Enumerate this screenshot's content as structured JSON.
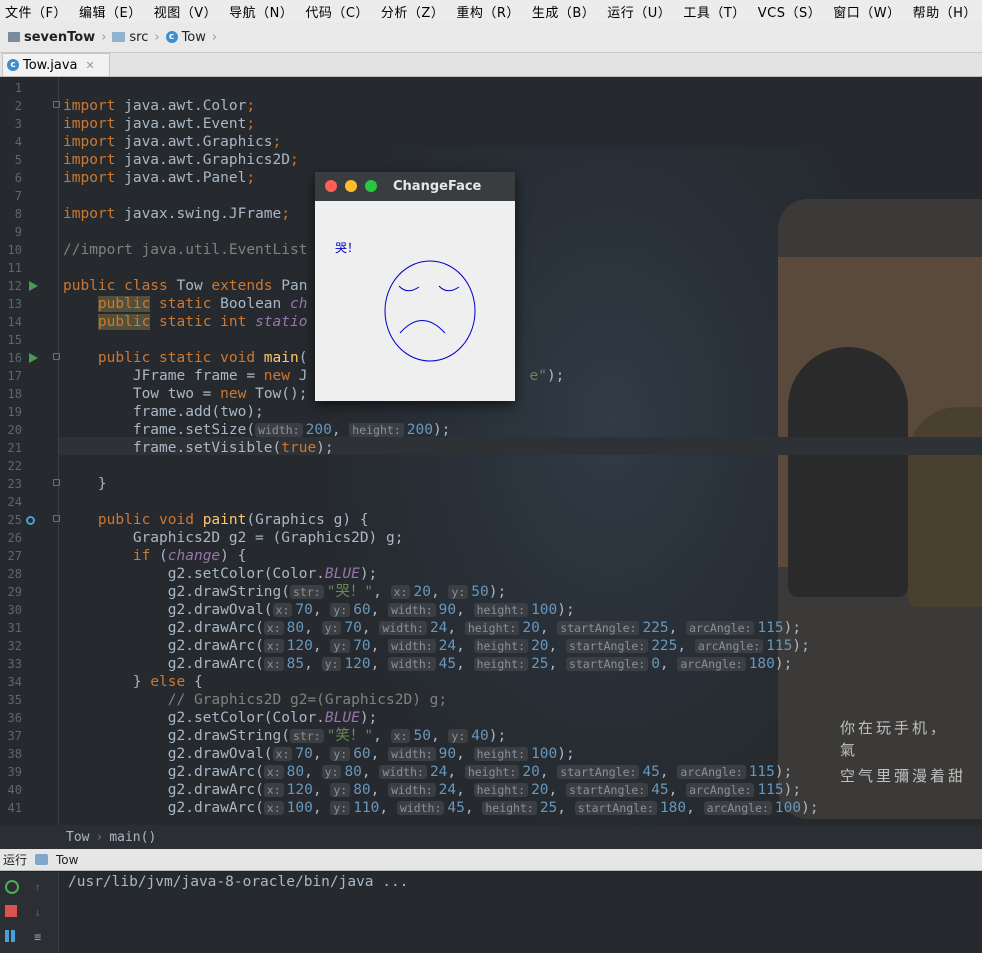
{
  "menu": [
    "文件（F）",
    "编辑（E）",
    "视图（V）",
    "导航（N）",
    "代码（C）",
    "分析（Z）",
    "重构（R）",
    "生成（B）",
    "运行（U）",
    "工具（T）",
    "VCS（S）",
    "窗口（W）",
    "帮助（H）"
  ],
  "breadcrumb": {
    "project": "sevenTow",
    "folder": "src",
    "class": "Tow"
  },
  "tab": {
    "label": "Tow.java"
  },
  "line_numbers": [
    "1",
    "2",
    "3",
    "4",
    "5",
    "6",
    "7",
    "8",
    "9",
    "10",
    "11",
    "12",
    "13",
    "14",
    "15",
    "16",
    "17",
    "18",
    "19",
    "20",
    "21",
    "22",
    "23",
    "24",
    "25",
    "26",
    "27",
    "28",
    "29",
    "30",
    "31",
    "32",
    "33",
    "34",
    "35",
    "36",
    "37",
    "38",
    "39",
    "40",
    "41"
  ],
  "code": {
    "l2": "import java.awt.Color;",
    "l3": "import java.awt.Event;",
    "l4": "import java.awt.Graphics;",
    "l5": "import java.awt.Graphics2D;",
    "l6": "import java.awt.Panel;",
    "l8": "import javax.swing.JFrame;",
    "l10": "//import java.util.EventList",
    "l12a": "public class",
    "l12b": " Tow ",
    "l12c": "extends",
    "l12d": " Pan",
    "l13a": "public",
    "l13b": " static",
    "l13c": " Boolean ",
    "l13d": "ch",
    "l14a": "public",
    "l14b": " static int ",
    "l14c": "statio",
    "l16a": "public static void ",
    "l16b": "main",
    "l17a": "JFrame frame = ",
    "l17b": "new",
    "l17c": " J",
    "l17d": "e\");",
    "l18a": "Tow two = ",
    "l18b": "new",
    "l18c": " Tow();",
    "l19": "frame.add(two);",
    "l20a": "frame.setSize(",
    "l20h1": "width:",
    "l20v1": "200",
    "l20h2": "height:",
    "l20v2": "200",
    "l20e": ");",
    "l21a": "frame.setVisible(",
    "l21b": "true",
    "l21c": ");",
    "l23": "}",
    "l25a": "public void ",
    "l25b": "paint",
    "l25c": "(Graphics g) {",
    "l26": "Graphics2D g2 = (Graphics2D) g;",
    "l27a": "if",
    "l27b": " (",
    "l27c": "change",
    "l27d": ") {",
    "l28a": "g2.setColor(Color.",
    "l28b": "BLUE",
    "l28c": ");",
    "l29a": "g2.drawString(",
    "l29h1": "str:",
    "l29s": "\"哭！\"",
    "l29h2": "x:",
    "l29v2": "20",
    "l29h3": "y:",
    "l29v3": "50",
    "l29e": ");",
    "l30a": "g2.drawOval(",
    "l30h1": "x:",
    "l30v1": "70",
    "l30h2": "y:",
    "l30v2": "60",
    "l30h3": "width:",
    "l30v3": "90",
    "l30h4": "height:",
    "l30v4": "100",
    "l30e": ");",
    "l31a": "g2.drawArc(",
    "l31h1": "x:",
    "l31v1": "80",
    "l31h2": "y:",
    "l31v2": "70",
    "l31h3": "width:",
    "l31v3": "24",
    "l31h4": "height:",
    "l31v4": "20",
    "l31h5": "startAngle:",
    "l31v5": "225",
    "l31h6": "arcAngle:",
    "l31v6": "115",
    "l31e": ");",
    "l32a": "g2.drawArc(",
    "l32h1": "x:",
    "l32v1": "120",
    "l32h2": "y:",
    "l32v2": "70",
    "l32h3": "width:",
    "l32v3": "24",
    "l32h4": "height:",
    "l32v4": "20",
    "l32h5": "startAngle:",
    "l32v5": "225",
    "l32h6": "arcAngle:",
    "l32v6": "115",
    "l32e": ");",
    "l33a": "g2.drawArc(",
    "l33h1": "x:",
    "l33v1": "85",
    "l33h2": "y:",
    "l33v2": "120",
    "l33h3": "width:",
    "l33v3": "45",
    "l33h4": "height:",
    "l33v4": "25",
    "l33h5": "startAngle:",
    "l33v5": "0",
    "l33h6": "arcAngle:",
    "l33v6": "180",
    "l33e": ");",
    "l34a": "} ",
    "l34b": "else",
    "l34c": " {",
    "l35": "// Graphics2D g2=(Graphics2D) g;",
    "l36a": "g2.setColor(Color.",
    "l36b": "BLUE",
    "l36c": ");",
    "l37a": "g2.drawString(",
    "l37h1": "str:",
    "l37s": "\"笑！\"",
    "l37h2": "x:",
    "l37v2": "50",
    "l37h3": "y:",
    "l37v3": "40",
    "l37e": ");",
    "l38a": "g2.drawOval(",
    "l38h1": "x:",
    "l38v1": "70",
    "l38h2": "y:",
    "l38v2": "60",
    "l38h3": "width:",
    "l38v3": "90",
    "l38h4": "height:",
    "l38v4": "100",
    "l38e": ");",
    "l39a": "g2.drawArc(",
    "l39h1": "x:",
    "l39v1": "80",
    "l39h2": "y:",
    "l39v2": "80",
    "l39h3": "width:",
    "l39v3": "24",
    "l39h4": "height:",
    "l39v4": "20",
    "l39h5": "startAngle:",
    "l39v5": "45",
    "l39h6": "arcAngle:",
    "l39v6": "115",
    "l39e": ");",
    "l40a": "g2.drawArc(",
    "l40h1": "x:",
    "l40v1": "120",
    "l40h2": "y:",
    "l40v2": "80",
    "l40h3": "width:",
    "l40v3": "24",
    "l40h4": "height:",
    "l40v4": "20",
    "l40h5": "startAngle:",
    "l40v5": "45",
    "l40h6": "arcAngle:",
    "l40v6": "115",
    "l40e": ");",
    "l41a": "g2.drawArc(",
    "l41h1": "x:",
    "l41v1": "100",
    "l41h2": "y:",
    "l41v2": "110",
    "l41h3": "width:",
    "l41v3": "45",
    "l41h4": "height:",
    "l41v4": "25",
    "l41h5": "startAngle:",
    "l41v5": "180",
    "l41h6": "arcAngle:",
    "l41v6": "100",
    "l41e": ");"
  },
  "status_breadcrumb": {
    "class": "Tow",
    "method": "main()"
  },
  "run_panel": {
    "label": "运行",
    "config": "Tow",
    "command": "/usr/lib/jvm/java-8-oracle/bin/java ..."
  },
  "popup": {
    "title": "ChangeFace",
    "text": "哭！"
  },
  "photo_text": {
    "line1": "你在玩手机，",
    "line2": "氣",
    "line3": "空气里彌漫着甜"
  },
  "colors": {
    "keyword": "#cc7832",
    "string": "#6a8759",
    "number": "#6897bb",
    "comment": "#808080",
    "function": "#ffc66d",
    "static_field": "#9876aa",
    "text": "#a9b7c6",
    "face_blue": "#0000cc"
  }
}
